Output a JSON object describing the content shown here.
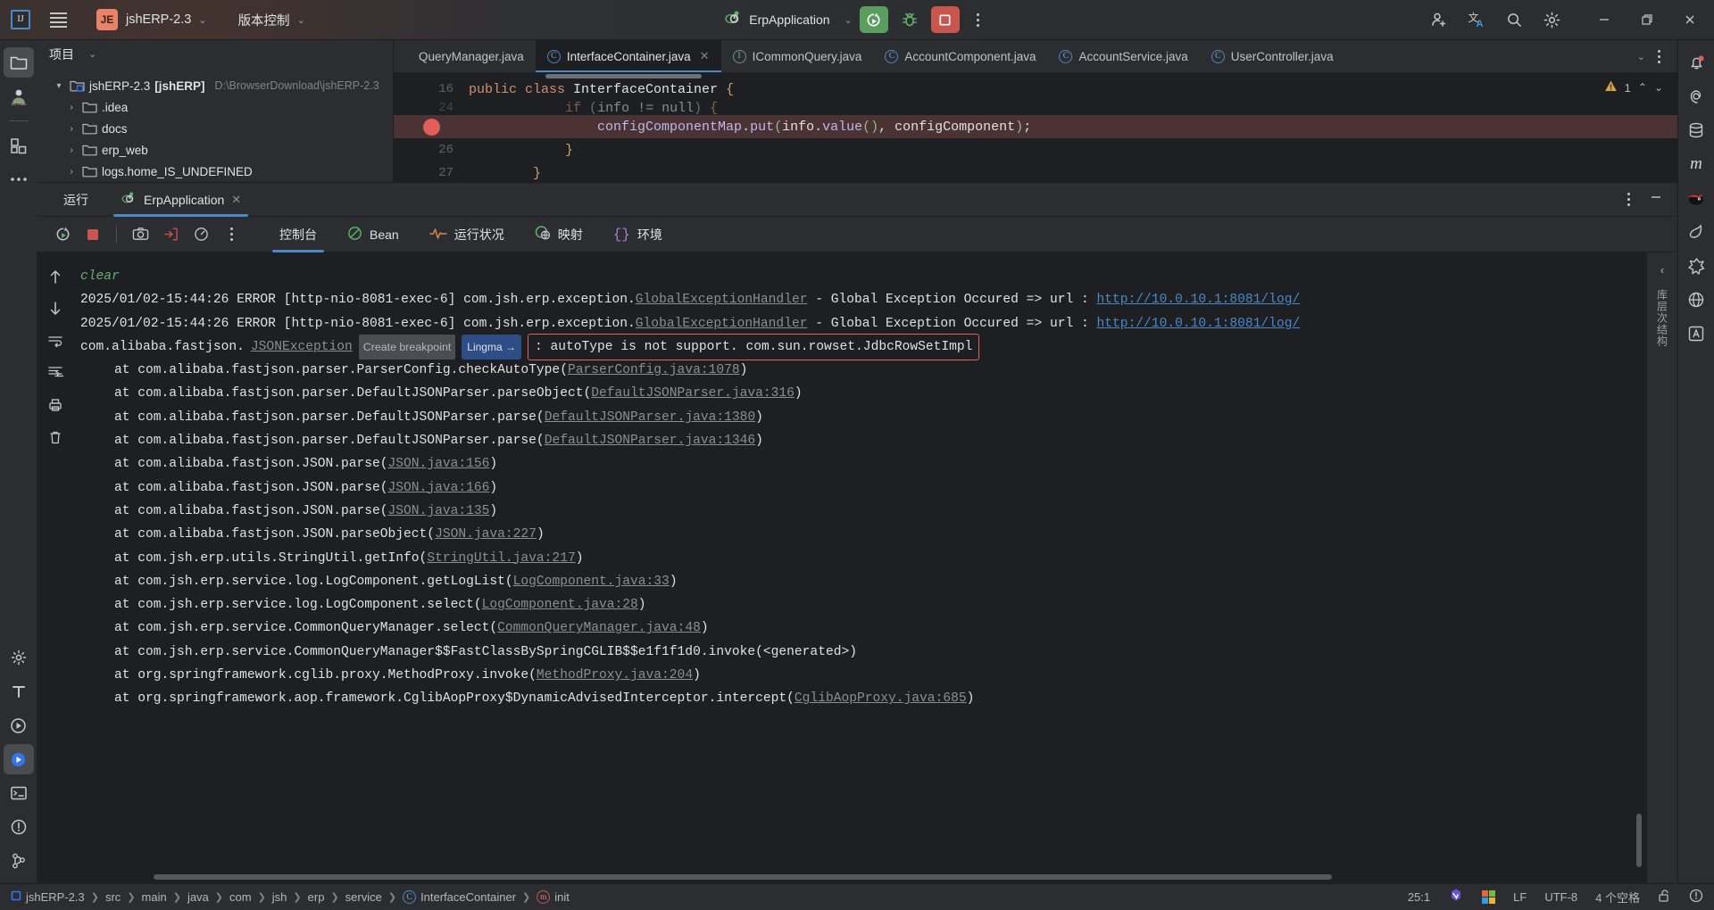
{
  "titlebar": {
    "ide_logo": "intellij-idea-logo",
    "menu_icon": "hamburger-menu-icon",
    "project_badge": "JE",
    "project_name": "jshERP-2.3",
    "vcs_label": "版本控制",
    "run_config_name": "ErpApplication",
    "run_icon": "run-icon",
    "debug_icon": "debug-bug-icon",
    "stop_icon": "stop-icon",
    "more_icon": "more-vertical-icon",
    "account_icon": "user-add-icon",
    "translate_icon": "translate-icon",
    "search_icon": "search-icon",
    "settings_icon": "gear-icon",
    "minimize_icon": "window-minimize-icon",
    "maximize_icon": "window-restore-icon",
    "close_icon": "window-close-icon"
  },
  "left_stripe": {
    "items": [
      {
        "name": "project-tool-window",
        "icon": "folder-icon",
        "active": true
      },
      {
        "name": "sg-team-plugin",
        "icon": "sg-team-icon",
        "active": false
      },
      {
        "name": "structure-tool-window",
        "icon": "structure-squares-icon",
        "active": false
      },
      {
        "name": "more-tool-windows",
        "icon": "ellipsis-icon",
        "active": false
      }
    ],
    "bottom_items": [
      {
        "name": "settings-sync",
        "icon": "gear-small-icon"
      },
      {
        "name": "translate-tool",
        "icon": "letter-t-icon"
      },
      {
        "name": "run-tool-window",
        "icon": "play-circle-icon"
      },
      {
        "name": "run-active",
        "icon": "run-green-icon",
        "active": true
      },
      {
        "name": "terminal-tool-window",
        "icon": "terminal-icon"
      },
      {
        "name": "problems-tool-window",
        "icon": "warning-circle-icon"
      },
      {
        "name": "version-control-tool-window",
        "icon": "git-branch-icon"
      }
    ]
  },
  "right_stripe": {
    "items": [
      {
        "name": "notifications",
        "icon": "bell-icon",
        "badge": true
      },
      {
        "name": "ai-assistant",
        "icon": "spiral-icon"
      },
      {
        "name": "database",
        "icon": "database-icon"
      },
      {
        "name": "maven",
        "icon": "letter-m-icon"
      },
      {
        "name": "ninja-plugin",
        "icon": "ninja-icon"
      },
      {
        "name": "leaf-plugin",
        "icon": "leaf-icon"
      },
      {
        "name": "spring",
        "icon": "spring-leaf-icon"
      },
      {
        "name": "endpoints",
        "icon": "globe-icon"
      },
      {
        "name": "translation",
        "icon": "letter-a-box-icon"
      }
    ]
  },
  "project_panel": {
    "title": "项目",
    "chevron_icon": "chevron-down-icon",
    "tree": [
      {
        "indent": 0,
        "arrow": "▼",
        "name": "jshERP-2.3",
        "module": "[jshERP]",
        "path": "D:\\BrowserDownload\\jshERP-2.3",
        "icon": "module-folder-icon"
      },
      {
        "indent": 1,
        "arrow": "›",
        "name": ".idea",
        "module": "",
        "path": "",
        "icon": "folder-icon"
      },
      {
        "indent": 1,
        "arrow": "›",
        "name": "docs",
        "module": "",
        "path": "",
        "icon": "folder-icon"
      },
      {
        "indent": 1,
        "arrow": "›",
        "name": "erp_web",
        "module": "",
        "path": "",
        "icon": "folder-icon"
      },
      {
        "indent": 1,
        "arrow": "›",
        "name": "logs.home_IS_UNDEFINED",
        "module": "",
        "path": "",
        "icon": "folder-icon"
      }
    ]
  },
  "editor": {
    "tabs": [
      {
        "label": "QueryManager.java",
        "icon": "",
        "active": false,
        "closable": false
      },
      {
        "label": "InterfaceContainer.java",
        "icon": "class-icon",
        "active": true,
        "closable": true
      },
      {
        "label": "ICommonQuery.java",
        "icon": "interface-icon",
        "active": false,
        "closable": false
      },
      {
        "label": "AccountComponent.java",
        "icon": "class-icon",
        "active": false,
        "closable": false
      },
      {
        "label": "AccountService.java",
        "icon": "class-icon",
        "active": false,
        "closable": false
      },
      {
        "label": "UserController.java",
        "icon": "class-icon",
        "active": false,
        "closable": false
      }
    ],
    "tabs_overflow_icon": "chevron-down-icon",
    "tabs_more_icon": "more-vertical-icon",
    "lines": [
      {
        "number": "16",
        "breakpoint": false,
        "highlighted": false,
        "tokens": [
          {
            "t": "kw",
            "v": "public "
          },
          {
            "t": "kw",
            "v": "class "
          },
          {
            "t": "cls",
            "v": "InterfaceContainer "
          },
          {
            "t": "br",
            "v": "{"
          }
        ]
      },
      {
        "number": "24",
        "breakpoint": false,
        "highlighted": false,
        "clipped": true,
        "tokens": [
          {
            "t": "plain",
            "v": "            "
          },
          {
            "t": "kw",
            "v": "if "
          },
          {
            "t": "par",
            "v": "("
          },
          {
            "t": "plain",
            "v": "info != null"
          },
          {
            "t": "par",
            "v": ") "
          },
          {
            "t": "br",
            "v": "{"
          }
        ]
      },
      {
        "number": "25",
        "breakpoint": true,
        "highlighted": true,
        "tokens": [
          {
            "t": "plain",
            "v": "                "
          },
          {
            "t": "meth",
            "v": "configComponentMap"
          },
          {
            "t": "plain",
            "v": "."
          },
          {
            "t": "meth",
            "v": "put"
          },
          {
            "t": "par",
            "v": "("
          },
          {
            "t": "plain",
            "v": "info."
          },
          {
            "t": "meth",
            "v": "value"
          },
          {
            "t": "par",
            "v": "()"
          },
          {
            "t": "plain",
            "v": ", configComponent"
          },
          {
            "t": "par",
            "v": ")"
          },
          {
            "t": "plain",
            "v": ";"
          }
        ]
      },
      {
        "number": "26",
        "breakpoint": false,
        "highlighted": false,
        "tokens": [
          {
            "t": "plain",
            "v": "            "
          },
          {
            "t": "br",
            "v": "}"
          }
        ]
      },
      {
        "number": "27",
        "breakpoint": false,
        "highlighted": false,
        "tokens": [
          {
            "t": "plain",
            "v": "        "
          },
          {
            "t": "br",
            "v": "}"
          }
        ]
      }
    ],
    "warning_icon": "warning-triangle-icon",
    "warning_count": "1",
    "prev_icon": "chevron-up-icon",
    "next_icon": "chevron-down-icon"
  },
  "run_panel": {
    "title": "运行",
    "tab_label": "ErpApplication",
    "tab_icon": "spring-run-icon",
    "tab_close_icon": "close-icon",
    "options_icon": "more-vertical-icon",
    "hide_icon": "minimize-icon",
    "toolbar": [
      {
        "name": "rerun-button",
        "icon": "rerun-icon"
      },
      {
        "name": "stop-button",
        "icon": "stop-square-icon"
      },
      {
        "name": "screenshot-button",
        "icon": "camera-icon"
      },
      {
        "name": "export-button",
        "icon": "export-icon"
      },
      {
        "name": "profiler-button",
        "icon": "gauge-icon"
      },
      {
        "name": "more-button",
        "icon": "more-vertical-icon"
      }
    ],
    "content_tabs": [
      {
        "label": "控制台",
        "icon": "",
        "active": true
      },
      {
        "label": "Bean",
        "icon": "bean-icon",
        "active": false
      },
      {
        "label": "运行状况",
        "icon": "health-pulse-icon",
        "active": false
      },
      {
        "label": "映射",
        "icon": "mappings-globe-icon",
        "active": false
      },
      {
        "label": "环境",
        "icon": "braces-icon",
        "active": false
      }
    ],
    "console_gutter": [
      {
        "name": "scroll-up-button",
        "icon": "arrow-up-icon"
      },
      {
        "name": "scroll-down-button",
        "icon": "arrow-down-icon"
      },
      {
        "name": "soft-wrap-button",
        "icon": "wrap-lines-icon"
      },
      {
        "name": "scroll-to-end-button",
        "icon": "scroll-end-icon"
      },
      {
        "name": "print-button",
        "icon": "print-icon"
      },
      {
        "name": "clear-all-button",
        "icon": "trash-icon"
      }
    ],
    "side_label": "库层次结构"
  },
  "console": {
    "lines": [
      {
        "type": "cmd",
        "indent": false,
        "segments": [
          {
            "s": "plain",
            "v": "clear"
          }
        ]
      },
      {
        "type": "log",
        "indent": false,
        "segments": [
          {
            "s": "plain",
            "v": "2025/01/02-15:44:26 ERROR [http-nio-8081-exec-6] com.jsh.erp.exception."
          },
          {
            "s": "exc",
            "v": "GlobalExceptionHandler"
          },
          {
            "s": "plain",
            "v": " - Global Exception Occured => url : "
          },
          {
            "s": "link",
            "v": "http://10.0.10.1:8081/log/"
          }
        ]
      },
      {
        "type": "log",
        "indent": false,
        "segments": [
          {
            "s": "plain",
            "v": "2025/01/02-15:44:26 ERROR [http-nio-8081-exec-6] com.jsh.erp.exception."
          },
          {
            "s": "exc",
            "v": "GlobalExceptionHandler"
          },
          {
            "s": "plain",
            "v": " - Global Exception Occured => url : "
          },
          {
            "s": "link",
            "v": "http://10.0.10.1:8081/log/"
          }
        ]
      },
      {
        "type": "exception",
        "indent": false,
        "segments": [
          {
            "s": "plain",
            "v": "com.alibaba.fastjson."
          },
          {
            "s": "exc",
            "v": "JSONException"
          },
          {
            "s": "breakpoint",
            "v": "Create breakpoint"
          },
          {
            "s": "lingma",
            "v": "Lingma →"
          },
          {
            "s": "errorbox",
            "v": ": autoType is not support. com.sun.rowset.JdbcRowSetImpl"
          }
        ]
      },
      {
        "type": "trace",
        "indent": true,
        "segments": [
          {
            "s": "plain",
            "v": "at com.alibaba.fastjson.parser.ParserConfig.checkAutoType("
          },
          {
            "s": "glink",
            "v": "ParserConfig.java:1078"
          },
          {
            "s": "plain",
            "v": ")"
          }
        ]
      },
      {
        "type": "trace",
        "indent": true,
        "segments": [
          {
            "s": "plain",
            "v": "at com.alibaba.fastjson.parser.DefaultJSONParser.parseObject("
          },
          {
            "s": "glink",
            "v": "DefaultJSONParser.java:316"
          },
          {
            "s": "plain",
            "v": ")"
          }
        ]
      },
      {
        "type": "trace",
        "indent": true,
        "segments": [
          {
            "s": "plain",
            "v": "at com.alibaba.fastjson.parser.DefaultJSONParser.parse("
          },
          {
            "s": "glink",
            "v": "DefaultJSONParser.java:1380"
          },
          {
            "s": "plain",
            "v": ")"
          }
        ]
      },
      {
        "type": "trace",
        "indent": true,
        "segments": [
          {
            "s": "plain",
            "v": "at com.alibaba.fastjson.parser.DefaultJSONParser.parse("
          },
          {
            "s": "glink",
            "v": "DefaultJSONParser.java:1346"
          },
          {
            "s": "plain",
            "v": ")"
          }
        ]
      },
      {
        "type": "trace",
        "indent": true,
        "segments": [
          {
            "s": "plain",
            "v": "at com.alibaba.fastjson.JSON.parse("
          },
          {
            "s": "glink",
            "v": "JSON.java:156"
          },
          {
            "s": "plain",
            "v": ")"
          }
        ]
      },
      {
        "type": "trace",
        "indent": true,
        "segments": [
          {
            "s": "plain",
            "v": "at com.alibaba.fastjson.JSON.parse("
          },
          {
            "s": "glink",
            "v": "JSON.java:166"
          },
          {
            "s": "plain",
            "v": ")"
          }
        ]
      },
      {
        "type": "trace",
        "indent": true,
        "segments": [
          {
            "s": "plain",
            "v": "at com.alibaba.fastjson.JSON.parse("
          },
          {
            "s": "glink",
            "v": "JSON.java:135"
          },
          {
            "s": "plain",
            "v": ")"
          }
        ]
      },
      {
        "type": "trace",
        "indent": true,
        "segments": [
          {
            "s": "plain",
            "v": "at com.alibaba.fastjson.JSON.parseObject("
          },
          {
            "s": "glink",
            "v": "JSON.java:227"
          },
          {
            "s": "plain",
            "v": ")"
          }
        ]
      },
      {
        "type": "trace",
        "indent": true,
        "segments": [
          {
            "s": "plain",
            "v": "at com.jsh.erp.utils.StringUtil.getInfo("
          },
          {
            "s": "glink",
            "v": "StringUtil.java:217"
          },
          {
            "s": "plain",
            "v": ")"
          }
        ]
      },
      {
        "type": "trace",
        "indent": true,
        "segments": [
          {
            "s": "plain",
            "v": "at com.jsh.erp.service.log.LogComponent.getLogList("
          },
          {
            "s": "glink",
            "v": "LogComponent.java:33"
          },
          {
            "s": "plain",
            "v": ")"
          }
        ]
      },
      {
        "type": "trace",
        "indent": true,
        "segments": [
          {
            "s": "plain",
            "v": "at com.jsh.erp.service.log.LogComponent.select("
          },
          {
            "s": "glink",
            "v": "LogComponent.java:28"
          },
          {
            "s": "plain",
            "v": ")"
          }
        ]
      },
      {
        "type": "trace",
        "indent": true,
        "segments": [
          {
            "s": "plain",
            "v": "at com.jsh.erp.service.CommonQueryManager.select("
          },
          {
            "s": "glink",
            "v": "CommonQueryManager.java:48"
          },
          {
            "s": "plain",
            "v": ")"
          }
        ]
      },
      {
        "type": "trace",
        "indent": true,
        "segments": [
          {
            "s": "plain",
            "v": "at com.jsh.erp.service.CommonQueryManager$$FastClassBySpringCGLIB$$e1f1f1d0.invoke(<generated>)"
          }
        ]
      },
      {
        "type": "trace",
        "indent": true,
        "segments": [
          {
            "s": "plain",
            "v": "at org.springframework.cglib.proxy.MethodProxy.invoke("
          },
          {
            "s": "glink",
            "v": "MethodProxy.java:204"
          },
          {
            "s": "plain",
            "v": ")"
          }
        ]
      },
      {
        "type": "trace",
        "indent": true,
        "segments": [
          {
            "s": "plain",
            "v": "at org.springframework.aop.framework.CglibAopProxy$DynamicAdvisedInterceptor.intercept("
          },
          {
            "s": "glink",
            "v": "CglibAopProxy.java:685"
          },
          {
            "s": "plain",
            "v": ")"
          }
        ]
      }
    ]
  },
  "status_bar": {
    "breadcrumbs": [
      {
        "label": "jshERP-2.3",
        "icon": "project-square-icon"
      },
      {
        "label": "src",
        "icon": ""
      },
      {
        "label": "main",
        "icon": ""
      },
      {
        "label": "java",
        "icon": ""
      },
      {
        "label": "com",
        "icon": ""
      },
      {
        "label": "jsh",
        "icon": ""
      },
      {
        "label": "erp",
        "icon": ""
      },
      {
        "label": "service",
        "icon": ""
      },
      {
        "label": "InterfaceContainer",
        "icon": "class-icon"
      },
      {
        "label": "init",
        "icon": "method-icon"
      }
    ],
    "caret_position": "25:1",
    "lingma_icon": "lingma-icon",
    "windows_icon": "windows-logo-icon",
    "line_separator": "LF",
    "encoding": "UTF-8",
    "indent": "4 个空格",
    "lock_icon": "unlock-icon",
    "inspection_icon": "inspection-circle-icon"
  },
  "colors": {
    "accent_blue": "#4a88c7",
    "run_green": "#599e5e",
    "stop_red": "#c9554f",
    "error_red": "#e8615c",
    "bg_dark": "#1e1f22",
    "bg_panel": "#2b2d30",
    "highlight_line": "#4b3233"
  }
}
